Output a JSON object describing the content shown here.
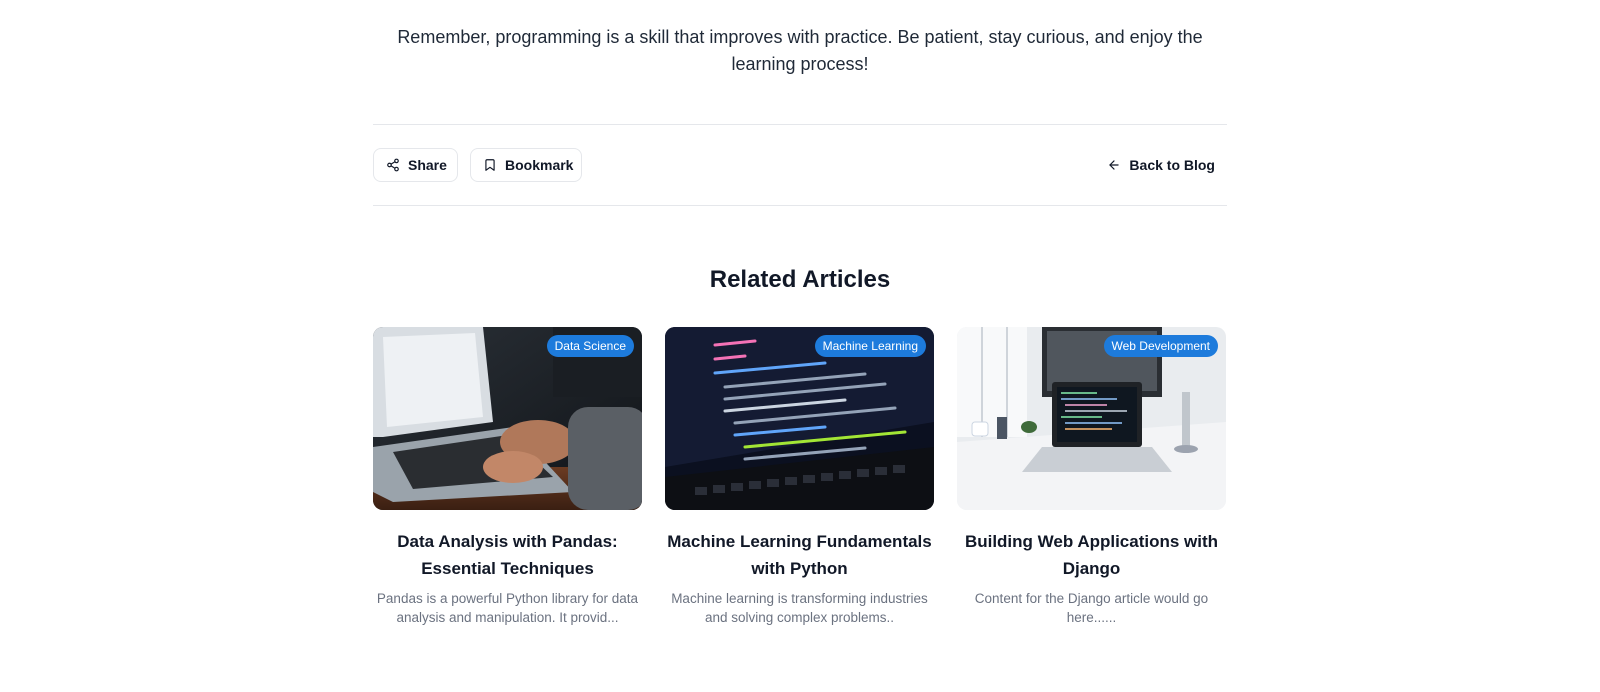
{
  "article": {
    "closing_text": "Remember, programming is a skill that improves with practice. Be patient, stay curious, and enjoy the learning process!"
  },
  "actions": {
    "share_label": "Share",
    "bookmark_label": "Bookmark",
    "back_label": "Back to Blog"
  },
  "related": {
    "heading": "Related Articles",
    "articles": [
      {
        "category": "Data Science",
        "title": "Data Analysis with Pandas: Essential Techniques",
        "excerpt": "Pandas is a powerful Python library for data analysis and manipulation. It provid..."
      },
      {
        "category": "Machine Learning",
        "title": "Machine Learning Fundamentals with Python",
        "excerpt": "Machine learning is transforming industries and solving complex problems.."
      },
      {
        "category": "Web Development",
        "title": "Building Web Applications with Django",
        "excerpt": "Content for the Django article would go here......"
      }
    ]
  },
  "colors": {
    "badge": "#1d7bdc",
    "text": "#111827",
    "muted": "#6b7280",
    "border": "#e5e7eb"
  },
  "icons": {
    "share": "share-icon",
    "bookmark": "bookmark-icon",
    "back": "arrow-left-icon"
  }
}
